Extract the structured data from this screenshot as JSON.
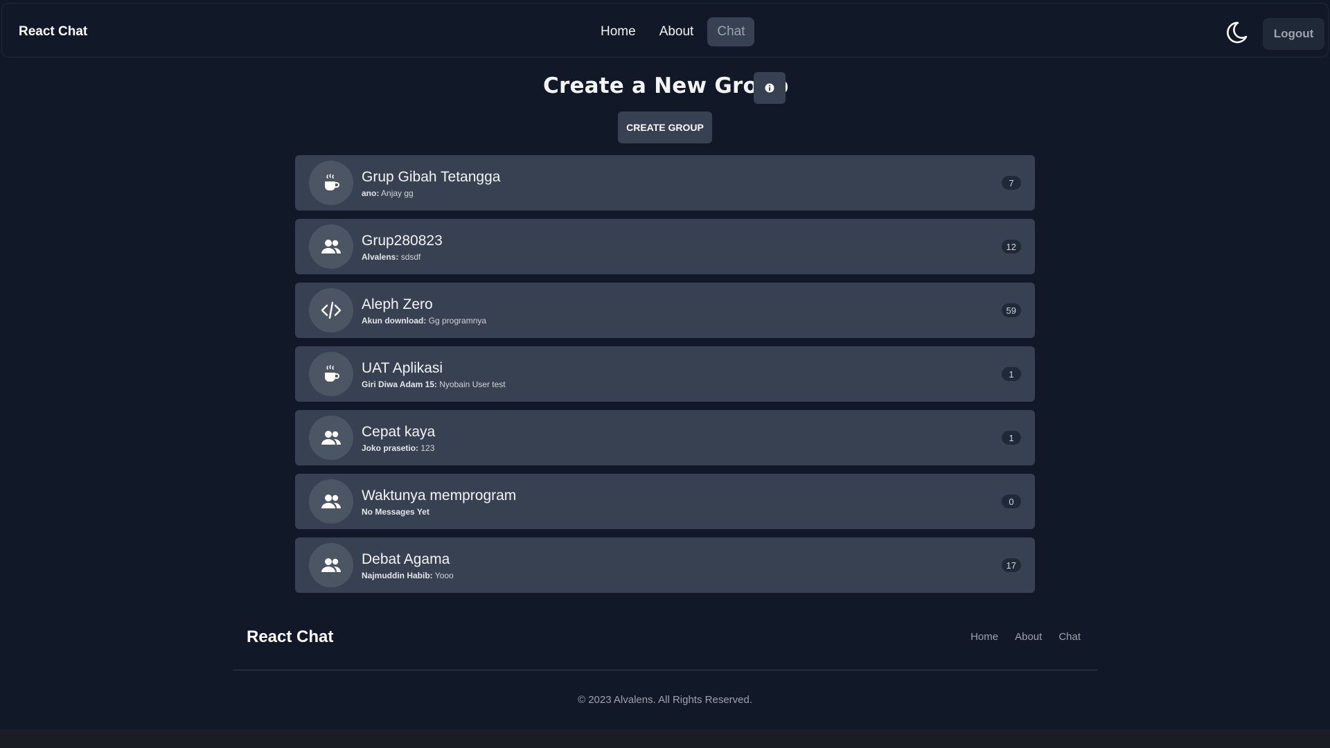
{
  "navbar": {
    "brand": "React Chat",
    "links": [
      {
        "label": "Home"
      },
      {
        "label": "About"
      },
      {
        "label": "Chat",
        "active": true
      }
    ],
    "theme_icon": "moon-icon",
    "logout_label": "Logout"
  },
  "header": {
    "title": "Create a New Group",
    "info_icon": "info-icon",
    "create_button_label": "CREATE GROUP"
  },
  "groups": [
    {
      "name": "Grup Gibah Tetangga",
      "sender": "ano:",
      "message": "Anjay gg",
      "count": "7",
      "icon": "coffee-icon"
    },
    {
      "name": "Grup280823",
      "sender": "Alvalens:",
      "message": "sdsdf",
      "count": "12",
      "icon": "users-icon"
    },
    {
      "name": "Aleph Zero",
      "sender": "Akun download:",
      "message": "Gg programnya",
      "count": "59",
      "icon": "code-icon"
    },
    {
      "name": "UAT Aplikasi",
      "sender": "Giri Diwa Adam 15:",
      "message": "Nyobain User test",
      "count": "1",
      "icon": "coffee-icon"
    },
    {
      "name": "Cepat kaya",
      "sender": "Joko prasetio:",
      "message": "123",
      "count": "1",
      "icon": "users-icon"
    },
    {
      "name": "Waktunya memprogram",
      "sender": "No Messages Yet",
      "message": "",
      "count": "0",
      "icon": "users-icon"
    },
    {
      "name": "Debat Agama",
      "sender": "Najmuddin Habib:",
      "message": "Yooo",
      "count": "17",
      "icon": "users-icon"
    }
  ],
  "footer": {
    "brand": "React Chat",
    "links": [
      "Home",
      "About",
      "Chat"
    ],
    "copyright": "© 2023 Alvalens. All Rights Reserved."
  },
  "colors": {
    "background": "#111827",
    "card": "#374151",
    "avatar": "#4b5563",
    "badge": "#1f2937"
  }
}
